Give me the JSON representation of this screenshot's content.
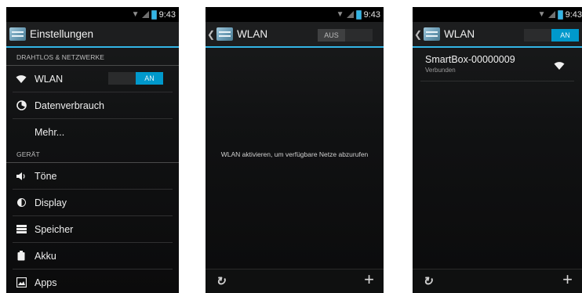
{
  "status_time": "9:43",
  "colors": {
    "accent": "#33b5e5",
    "toggle_on": "#0099cc",
    "background": "#111213"
  },
  "screen1": {
    "title": "Einstellungen",
    "sections": [
      {
        "header": "DRAHTLOS & NETZWERKE"
      },
      {
        "header": "GERÄT"
      }
    ],
    "items": {
      "wlan": {
        "label": "WLAN",
        "icon": "wifi-icon",
        "toggle": "AN"
      },
      "data": {
        "label": "Datenverbrauch",
        "icon": "data-usage-icon"
      },
      "more": {
        "label": "Mehr..."
      },
      "sound": {
        "label": "Töne",
        "icon": "speaker-icon"
      },
      "display": {
        "label": "Display",
        "icon": "brightness-icon"
      },
      "storage": {
        "label": "Speicher",
        "icon": "storage-icon"
      },
      "battery": {
        "label": "Akku",
        "icon": "battery-icon"
      },
      "apps": {
        "label": "Apps",
        "icon": "apps-icon"
      }
    }
  },
  "screen2": {
    "title": "WLAN",
    "toggle": "AUS",
    "message": "WLAN aktivieren, um verfügbare Netze abzurufen",
    "bottom": {
      "refresh_icon": "refresh-icon",
      "add": "+"
    }
  },
  "screen3": {
    "title": "WLAN",
    "toggle": "AN",
    "network": {
      "name": "SmartBox-00000009",
      "status": "Verbunden",
      "icon": "wifi-signal-icon"
    },
    "bottom": {
      "refresh_icon": "refresh-icon",
      "add": "+"
    }
  }
}
